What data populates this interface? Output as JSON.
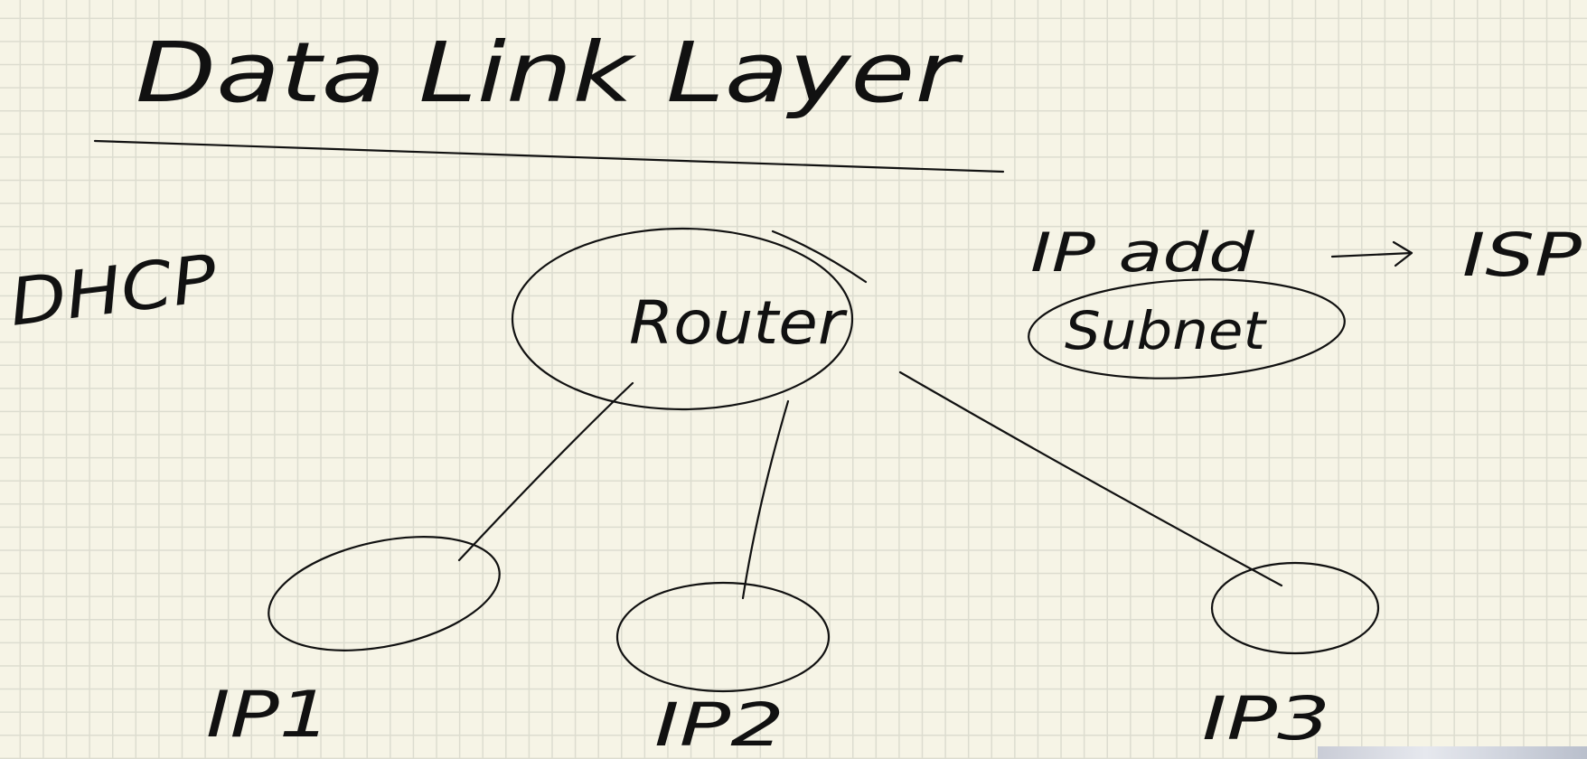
{
  "title": "Data Link Layer",
  "labels": {
    "protocol": "DHCP",
    "router": "Router",
    "ip_add": "IP add",
    "isp": "ISP",
    "subnet": "Subnet",
    "nodes": [
      "IP1",
      "IP2",
      "IP3"
    ]
  },
  "colors": {
    "paper": "#f6f4e6",
    "grid": "#dcdccf",
    "ink": "#111111"
  }
}
